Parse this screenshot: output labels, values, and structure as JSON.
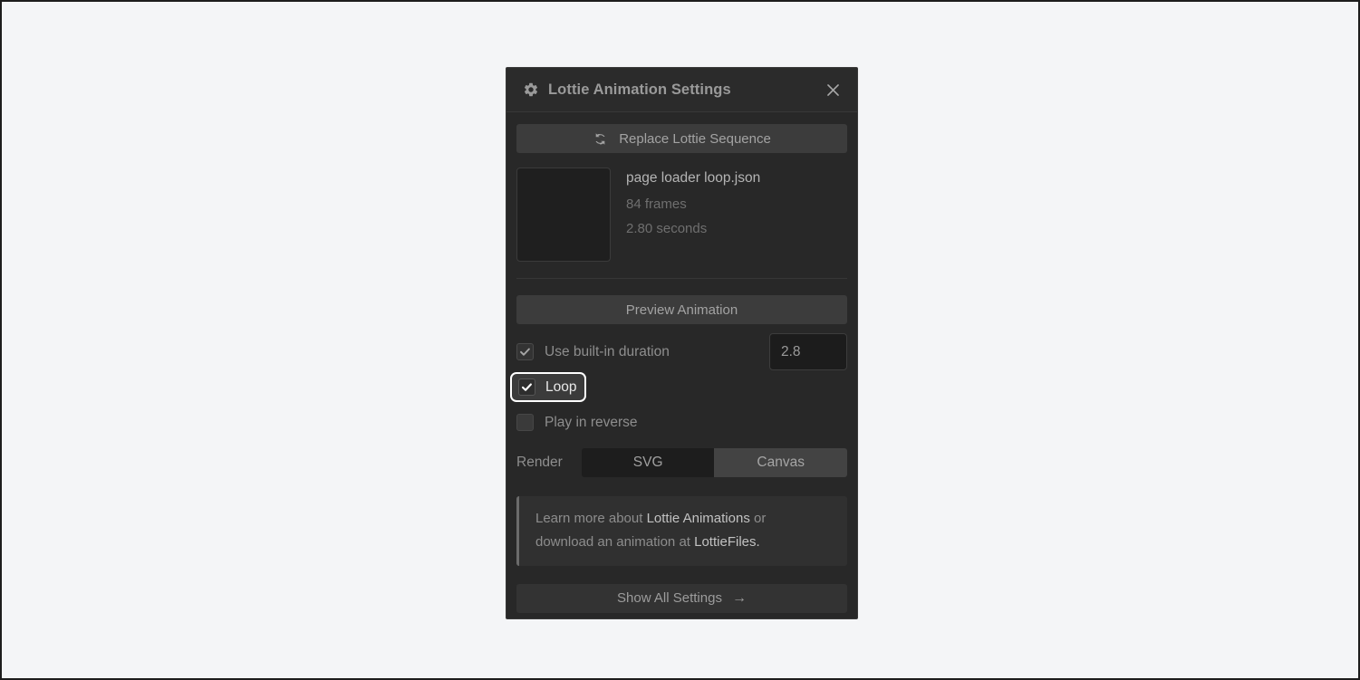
{
  "panel": {
    "title": "Lottie Animation Settings",
    "gear_icon": "gear-icon",
    "close_icon": "close-icon"
  },
  "replace": {
    "label": "Replace Lottie Sequence",
    "icon": "refresh-icon"
  },
  "file": {
    "name": "page loader loop.json",
    "frames": "84 frames",
    "duration": "2.80 seconds"
  },
  "preview": {
    "label": "Preview Animation"
  },
  "options": [
    {
      "label": "Use built-in duration",
      "checked": true,
      "focused": false
    },
    {
      "label": "Loop",
      "checked": true,
      "focused": true
    },
    {
      "label": "Play in reverse",
      "checked": false,
      "focused": false
    }
  ],
  "duration_field": {
    "value": "2.8",
    "placeholder": "2.8"
  },
  "render": {
    "label": "Render",
    "options": [
      "SVG",
      "Canvas"
    ],
    "selected": "SVG"
  },
  "note": {
    "line1_a": "Learn more about ",
    "line1_link": "Lottie Animations",
    "line1_b": " or",
    "line2_a": "download an animation at ",
    "line2_link": "LottieFiles."
  },
  "footer": {
    "label": "Show All Settings",
    "arrow": "→"
  },
  "colors": {
    "page_bg": "#f4f5f7",
    "panel_bg": "#282828",
    "header_bg": "#2b2b2b",
    "focus_ring": "#ffffff",
    "accent_bar": "#6b6b6b",
    "text_primary": "#b4b4b4",
    "text_muted": "#6f6f6f"
  }
}
